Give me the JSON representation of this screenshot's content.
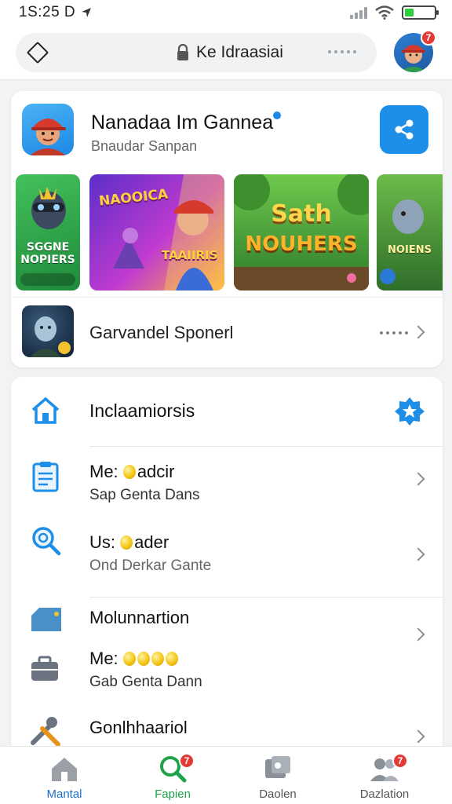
{
  "status_bar": {
    "time": "1S:25 D",
    "battery_level": 0.3,
    "battery_color": "#2ecc40"
  },
  "top_bar": {
    "url_text": "Ke Idraasiai",
    "avatar_badge": "7"
  },
  "profile": {
    "name": "Nanadaa Im Gannea",
    "subtitle": "Bnaudar Sanpan"
  },
  "game_tiles": [
    {
      "text_lines": [
        "SGGNE",
        "NOPIERS"
      ],
      "corner_label": "",
      "color": "#2fa84f"
    },
    {
      "text_lines": [
        "NAOOICA",
        "TAAIIRIS"
      ],
      "corner_label": "",
      "color": "#7b4fd6"
    },
    {
      "text_lines": [
        "Sath",
        "NOUHERS"
      ],
      "corner_label": "",
      "color": "#3f9e3a"
    },
    {
      "text_lines": [
        "NOIENS"
      ],
      "corner_label": "",
      "color": "#4a8e3c"
    }
  ],
  "sponsored": {
    "label": "Garvandel Sponerl"
  },
  "list": [
    {
      "title": "Inclaamiorsis",
      "icon": "home-icon"
    },
    {
      "title": "Me:",
      "title_suffix": "adcir",
      "subtitle": "Sap Genta Dans",
      "icon": "clipboard-icon"
    },
    {
      "title": "Us:",
      "title_suffix": "ader",
      "subtitle": "Ond Derkar Gante",
      "icon": "search-icon"
    },
    {
      "title": "Molunnartion",
      "icon": "tag-icon"
    },
    {
      "title": "Me:",
      "subtitle": "Gab Genta Dann",
      "icon": "briefcase-icon"
    },
    {
      "title": "Gonlhhaariol",
      "icon": "tools-icon"
    }
  ],
  "bottom_nav": [
    {
      "label": "Mantal",
      "icon": "home-icon",
      "badge": "",
      "active": false
    },
    {
      "label": "Fapien",
      "icon": "search-icon",
      "badge": "7",
      "active": true
    },
    {
      "label": "Daolen",
      "icon": "gallery-icon",
      "badge": "",
      "active": false
    },
    {
      "label": "Dazlation",
      "icon": "users-icon",
      "badge": "7",
      "active": false
    }
  ],
  "colors": {
    "accent": "#1e8fe8",
    "badge": "#e53935",
    "active_nav": "#1fa34a"
  }
}
